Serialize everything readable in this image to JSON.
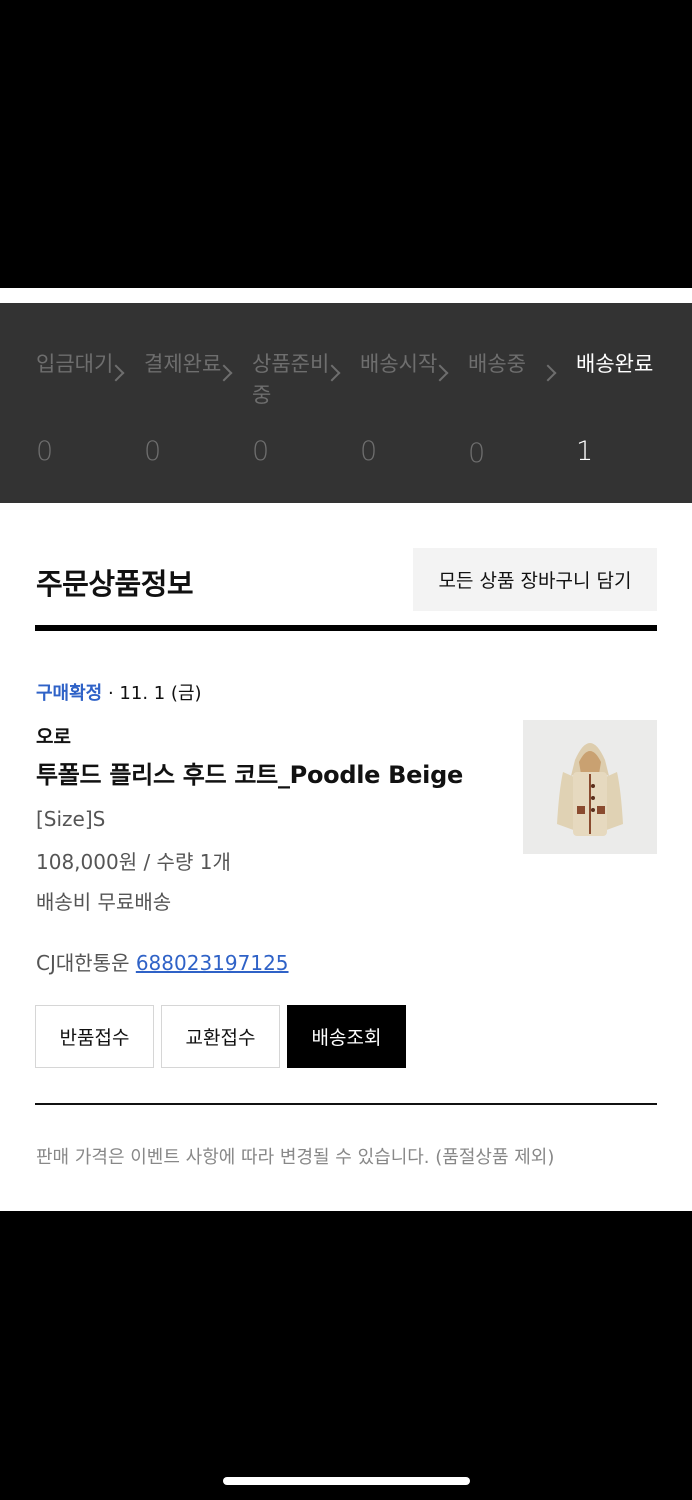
{
  "order_steps": [
    {
      "label": "입금대기",
      "count": "0",
      "active": false
    },
    {
      "label": "결제완료",
      "count": "0",
      "active": false
    },
    {
      "label": "상품준비중",
      "count": "0",
      "active": false
    },
    {
      "label": "배송시작",
      "count": "0",
      "active": false
    },
    {
      "label": "배송중",
      "count": "0",
      "active": false
    },
    {
      "label": "배송완료",
      "count": "1",
      "active": true
    }
  ],
  "section": {
    "title": "주문상품정보",
    "cart_all_label": "모든 상품 장바구니 담기"
  },
  "item": {
    "status": "구매확정",
    "date": " · 11. 1 (금)",
    "brand": "오로",
    "name": "투폴드 플리스 후드 코트_Poodle Beige",
    "size": "[Size]S",
    "price_qty": "108,000원 / 수량 1개",
    "shipping": "배송비 무료배송",
    "courier": "CJ대한통운 ",
    "tracking_number": "688023197125",
    "image_alt": "beige fleece hooded coat"
  },
  "actions": {
    "return_label": "반품접수",
    "exchange_label": "교환접수",
    "tracking_label": "배송조회"
  },
  "notice": "판매 가격은 이벤트 사항에 따라 변경될 수 있습니다. (품절상품 제외)",
  "colors": {
    "status_bar_bg": "#333333",
    "link_blue": "#2f62c7",
    "inactive_step": "#6e6e6e"
  }
}
